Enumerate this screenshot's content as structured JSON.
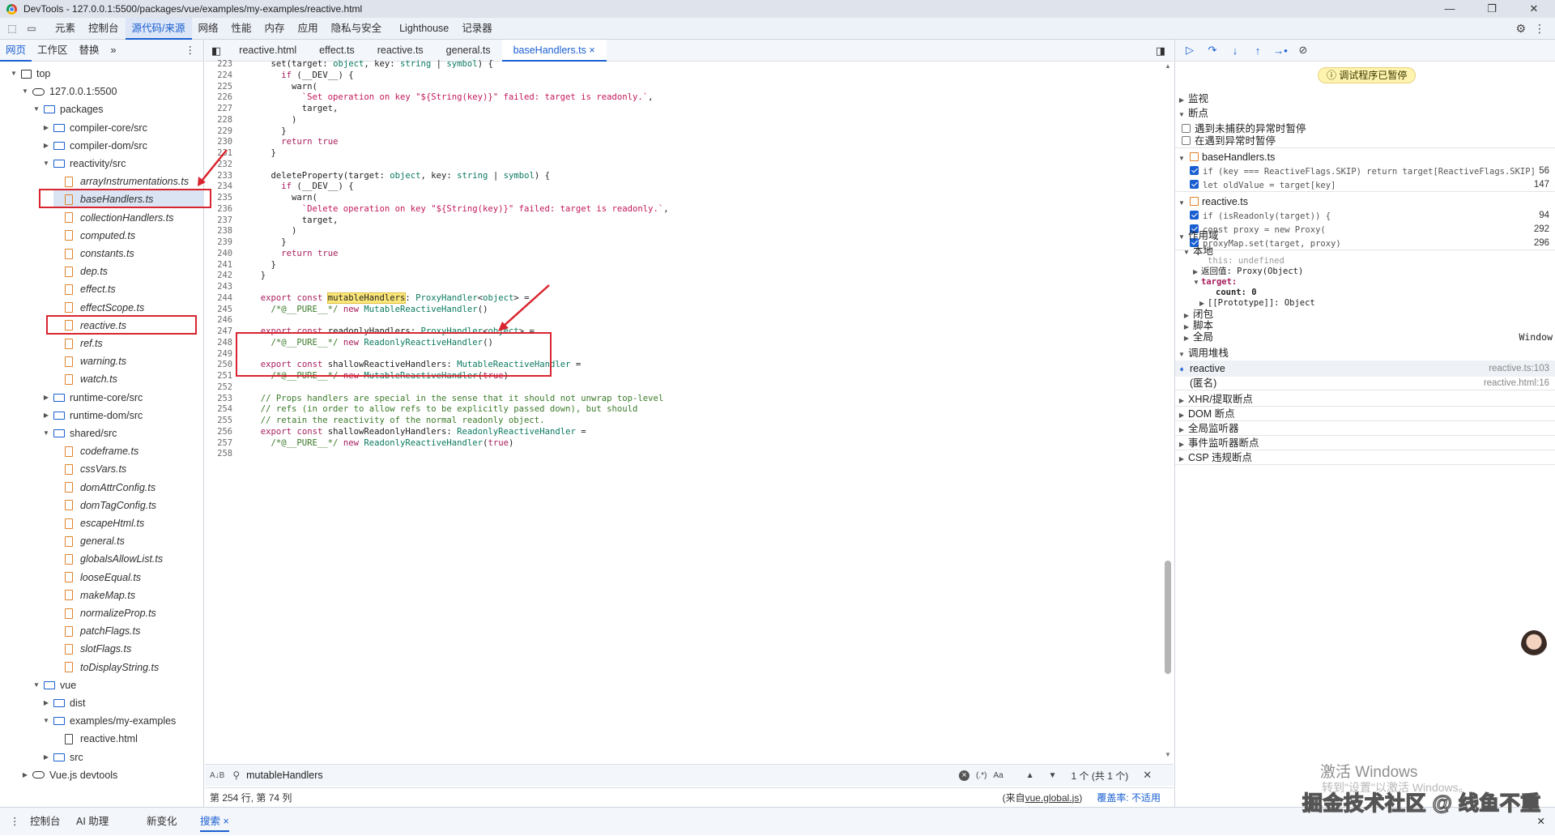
{
  "window": {
    "title": "DevTools - 127.0.0.1:5500/packages/vue/examples/my-examples/reactive.html",
    "controls": [
      "—",
      "❐",
      "✕"
    ]
  },
  "main_tabs": [
    "元素",
    "控制台",
    "源代码/来源",
    "网络",
    "性能",
    "内存",
    "应用",
    "隐私与安全",
    "Lighthouse",
    "记录器"
  ],
  "navigator": {
    "tabs": [
      "网页",
      "工作区",
      "替换"
    ],
    "more": "»",
    "tree": [
      {
        "label": "top",
        "icon": "frame",
        "depth": 0,
        "arrow": "▼"
      },
      {
        "label": "127.0.0.1:5500",
        "icon": "cloud",
        "depth": 1,
        "arrow": "▼"
      },
      {
        "label": "packages",
        "icon": "folder",
        "depth": 2,
        "arrow": "▼"
      },
      {
        "label": "compiler-core/src",
        "icon": "folder",
        "depth": 3,
        "arrow": "▶"
      },
      {
        "label": "compiler-dom/src",
        "icon": "folder",
        "depth": 3,
        "arrow": "▶"
      },
      {
        "label": "reactivity/src",
        "icon": "folder",
        "depth": 3,
        "arrow": "▼"
      },
      {
        "label": "arrayInstrumentations.ts",
        "icon": "file",
        "depth": 4
      },
      {
        "label": "baseHandlers.ts",
        "icon": "file",
        "depth": 4,
        "selected": true
      },
      {
        "label": "collectionHandlers.ts",
        "icon": "file",
        "depth": 4
      },
      {
        "label": "computed.ts",
        "icon": "file",
        "depth": 4
      },
      {
        "label": "constants.ts",
        "icon": "file",
        "depth": 4
      },
      {
        "label": "dep.ts",
        "icon": "file",
        "depth": 4
      },
      {
        "label": "effect.ts",
        "icon": "file",
        "depth": 4
      },
      {
        "label": "effectScope.ts",
        "icon": "file",
        "depth": 4
      },
      {
        "label": "reactive.ts",
        "icon": "file",
        "depth": 4
      },
      {
        "label": "ref.ts",
        "icon": "file",
        "depth": 4
      },
      {
        "label": "warning.ts",
        "icon": "file",
        "depth": 4
      },
      {
        "label": "watch.ts",
        "icon": "file",
        "depth": 4
      },
      {
        "label": "runtime-core/src",
        "icon": "folder",
        "depth": 3,
        "arrow": "▶"
      },
      {
        "label": "runtime-dom/src",
        "icon": "folder",
        "depth": 3,
        "arrow": "▶"
      },
      {
        "label": "shared/src",
        "icon": "folder",
        "depth": 3,
        "arrow": "▼"
      },
      {
        "label": "codeframe.ts",
        "icon": "file",
        "depth": 4
      },
      {
        "label": "cssVars.ts",
        "icon": "file",
        "depth": 4
      },
      {
        "label": "domAttrConfig.ts",
        "icon": "file",
        "depth": 4
      },
      {
        "label": "domTagConfig.ts",
        "icon": "file",
        "depth": 4
      },
      {
        "label": "escapeHtml.ts",
        "icon": "file",
        "depth": 4
      },
      {
        "label": "general.ts",
        "icon": "file",
        "depth": 4
      },
      {
        "label": "globalsAllowList.ts",
        "icon": "file",
        "depth": 4
      },
      {
        "label": "looseEqual.ts",
        "icon": "file",
        "depth": 4
      },
      {
        "label": "makeMap.ts",
        "icon": "file",
        "depth": 4
      },
      {
        "label": "normalizeProp.ts",
        "icon": "file",
        "depth": 4
      },
      {
        "label": "patchFlags.ts",
        "icon": "file",
        "depth": 4
      },
      {
        "label": "slotFlags.ts",
        "icon": "file",
        "depth": 4
      },
      {
        "label": "toDisplayString.ts",
        "icon": "file",
        "depth": 4
      },
      {
        "label": "vue",
        "icon": "folder",
        "depth": 2,
        "arrow": "▼"
      },
      {
        "label": "dist",
        "icon": "folder",
        "depth": 3,
        "arrow": "▶"
      },
      {
        "label": "examples/my-examples",
        "icon": "folder",
        "depth": 3,
        "arrow": "▼"
      },
      {
        "label": "reactive.html",
        "icon": "file-dark",
        "depth": 4,
        "plain": true
      },
      {
        "label": "src",
        "icon": "folder",
        "depth": 3,
        "arrow": "▶"
      },
      {
        "label": "Vue.js devtools",
        "icon": "cloud",
        "depth": 1,
        "arrow": "▶",
        "plain": true
      }
    ]
  },
  "editor": {
    "tabs": [
      "reactive.html",
      "effect.ts",
      "reactive.ts",
      "general.ts",
      "baseHandlers.ts"
    ],
    "active_tab_close": "×",
    "lines": [
      {
        "n": "223",
        "html": "    set(target: <span class='ty'>object</span>, key: <span class='ty'>string</span> | <span class='ty'>symbol</span>) {"
      },
      {
        "n": "224",
        "html": "      <span class='kw'>if</span> (__DEV__) {"
      },
      {
        "n": "225",
        "html": "        warn("
      },
      {
        "n": "226",
        "html": "          <span class='st'>`Set operation on key \"${String(key)}\" failed: target is readonly.`</span>,"
      },
      {
        "n": "227",
        "html": "          target,"
      },
      {
        "n": "228",
        "html": "        )"
      },
      {
        "n": "229",
        "html": "      }"
      },
      {
        "n": "230",
        "html": "      <span class='kw'>return</span> <span class='kw'>true</span>"
      },
      {
        "n": "231",
        "html": "    }"
      },
      {
        "n": "232",
        "html": ""
      },
      {
        "n": "233",
        "html": "    deleteProperty(target: <span class='ty'>object</span>, key: <span class='ty'>string</span> | <span class='ty'>symbol</span>) {"
      },
      {
        "n": "234",
        "html": "      <span class='kw'>if</span> (__DEV__) {"
      },
      {
        "n": "235",
        "html": "        warn("
      },
      {
        "n": "236",
        "html": "          <span class='st'>`Delete operation on key \"${String(key)}\" failed: target is readonly.`</span>,"
      },
      {
        "n": "237",
        "html": "          target,"
      },
      {
        "n": "238",
        "html": "        )"
      },
      {
        "n": "239",
        "html": "      }"
      },
      {
        "n": "240",
        "html": "      <span class='kw'>return</span> <span class='kw'>true</span>"
      },
      {
        "n": "241",
        "html": "    }"
      },
      {
        "n": "242",
        "html": "  }"
      },
      {
        "n": "243",
        "html": ""
      },
      {
        "n": "244",
        "html": "  <span class='kw'>export</span> <span class='kw'>const</span> <span class='hl'>mutableHandlers</span>: <span class='ty'>ProxyHandler</span>&lt;<span class='ty'>object</span>&gt; ="
      },
      {
        "n": "245",
        "html": "    <span class='cm'>/*@__PURE__*/</span> <span class='kw'>new</span> <span class='ty'>MutableReactiveHandler</span>()"
      },
      {
        "n": "246",
        "html": ""
      },
      {
        "n": "247",
        "html": "  <span class='kw'>export</span> <span class='kw'>const</span> readonlyHandlers: <span class='ty'>ProxyHandler</span>&lt;<span class='ty'>object</span>&gt; ="
      },
      {
        "n": "248",
        "html": "    <span class='cm'>/*@__PURE__*/</span> <span class='kw'>new</span> <span class='ty'>ReadonlyReactiveHandler</span>()"
      },
      {
        "n": "249",
        "html": ""
      },
      {
        "n": "250",
        "html": "  <span class='kw'>export</span> <span class='kw'>const</span> shallowReactiveHandlers: <span class='ty'>MutableReactiveHandler</span> ="
      },
      {
        "n": "251",
        "html": "    <span class='cm'>/*@__PURE__*/</span> <span class='kw'>new</span> <span class='ty'>MutableReactiveHandler</span>(<span class='kw'>true</span>)"
      },
      {
        "n": "252",
        "html": ""
      },
      {
        "n": "253",
        "html": "  <span class='cm'>// Props handlers are special in the sense that it should not unwrap top-level</span>"
      },
      {
        "n": "254",
        "html": "  <span class='cm'>// refs (in order to allow refs to be explicitly passed down), but should</span>"
      },
      {
        "n": "255",
        "html": "  <span class='cm'>// retain the reactivity of the normal readonly object.</span>"
      },
      {
        "n": "256",
        "html": "  <span class='kw'>export</span> <span class='kw'>const</span> shallowReadonlyHandlers: <span class='ty'>ReadonlyReactiveHandler</span> ="
      },
      {
        "n": "257",
        "html": "    <span class='cm'>/*@__PURE__*/</span> <span class='kw'>new</span> <span class='ty'>ReadonlyReactiveHandler</span>(<span class='kw'>true</span>)"
      },
      {
        "n": "258",
        "html": ""
      }
    ]
  },
  "search": {
    "query": "mutableHandlers",
    "regex": "(.*)",
    "case": "Aa",
    "up": "▲",
    "down": "▼",
    "count": "1 个 (共 1 个)",
    "close": "✕"
  },
  "status": {
    "position": "第 254 行, 第 74 列",
    "source_prefix": "(来自 ",
    "source_link": "vue.global.js",
    "source_suffix": ")",
    "coverage": "覆盖率: 不适用"
  },
  "debugger": {
    "paused_label": "调试程序已暂停",
    "watch": "监视",
    "breakpoints": "断点",
    "pause_uncaught": "遇到未捕获的异常时暂停",
    "pause_caught": "在遇到异常时暂停",
    "bp_groups": [
      {
        "file": "baseHandlers.ts",
        "items": [
          {
            "code": "if (key === ReactiveFlags.SKIP) return target[ReactiveFlags.SKIP]",
            "line": "56"
          },
          {
            "code": "let oldValue = target[key]",
            "line": "147"
          }
        ]
      },
      {
        "file": "reactive.ts",
        "items": [
          {
            "code": "if (isReadonly(target)) {",
            "line": "94"
          },
          {
            "code": "const proxy = new Proxy(",
            "line": "292"
          },
          {
            "code": "proxyMap.set(target, proxy)",
            "line": "296"
          }
        ]
      }
    ],
    "scope": "作用域",
    "local": "本地",
    "scope_this": "this: undefined",
    "scope_return": "返回值: Proxy(Object)",
    "scope_target": "target:",
    "scope_count": "count: 0",
    "scope_proto": "[[Prototype]]: Object",
    "closure": "闭包",
    "script": "脚本",
    "global": "全局",
    "global_value": "Window",
    "callstack": "调用堆栈",
    "frames": [
      {
        "name": "reactive",
        "loc": "reactive.ts:103"
      },
      {
        "name": "(匿名)",
        "loc": "reactive.html:16"
      }
    ],
    "more_sections": [
      "XHR/提取断点",
      "DOM 断点",
      "全局监听器",
      "事件监听器断点",
      "CSP 违规断点"
    ]
  },
  "drawer_tabs": [
    "控制台",
    "AI 助理",
    "新变化",
    "搜索"
  ],
  "drawer_close": "✕",
  "overlay": {
    "windows_line1": "激活 Windows",
    "windows_line2": "转到\"设置\"以激活 Windows。",
    "juejin": "掘金技术社区 @ 线鱼不重"
  }
}
